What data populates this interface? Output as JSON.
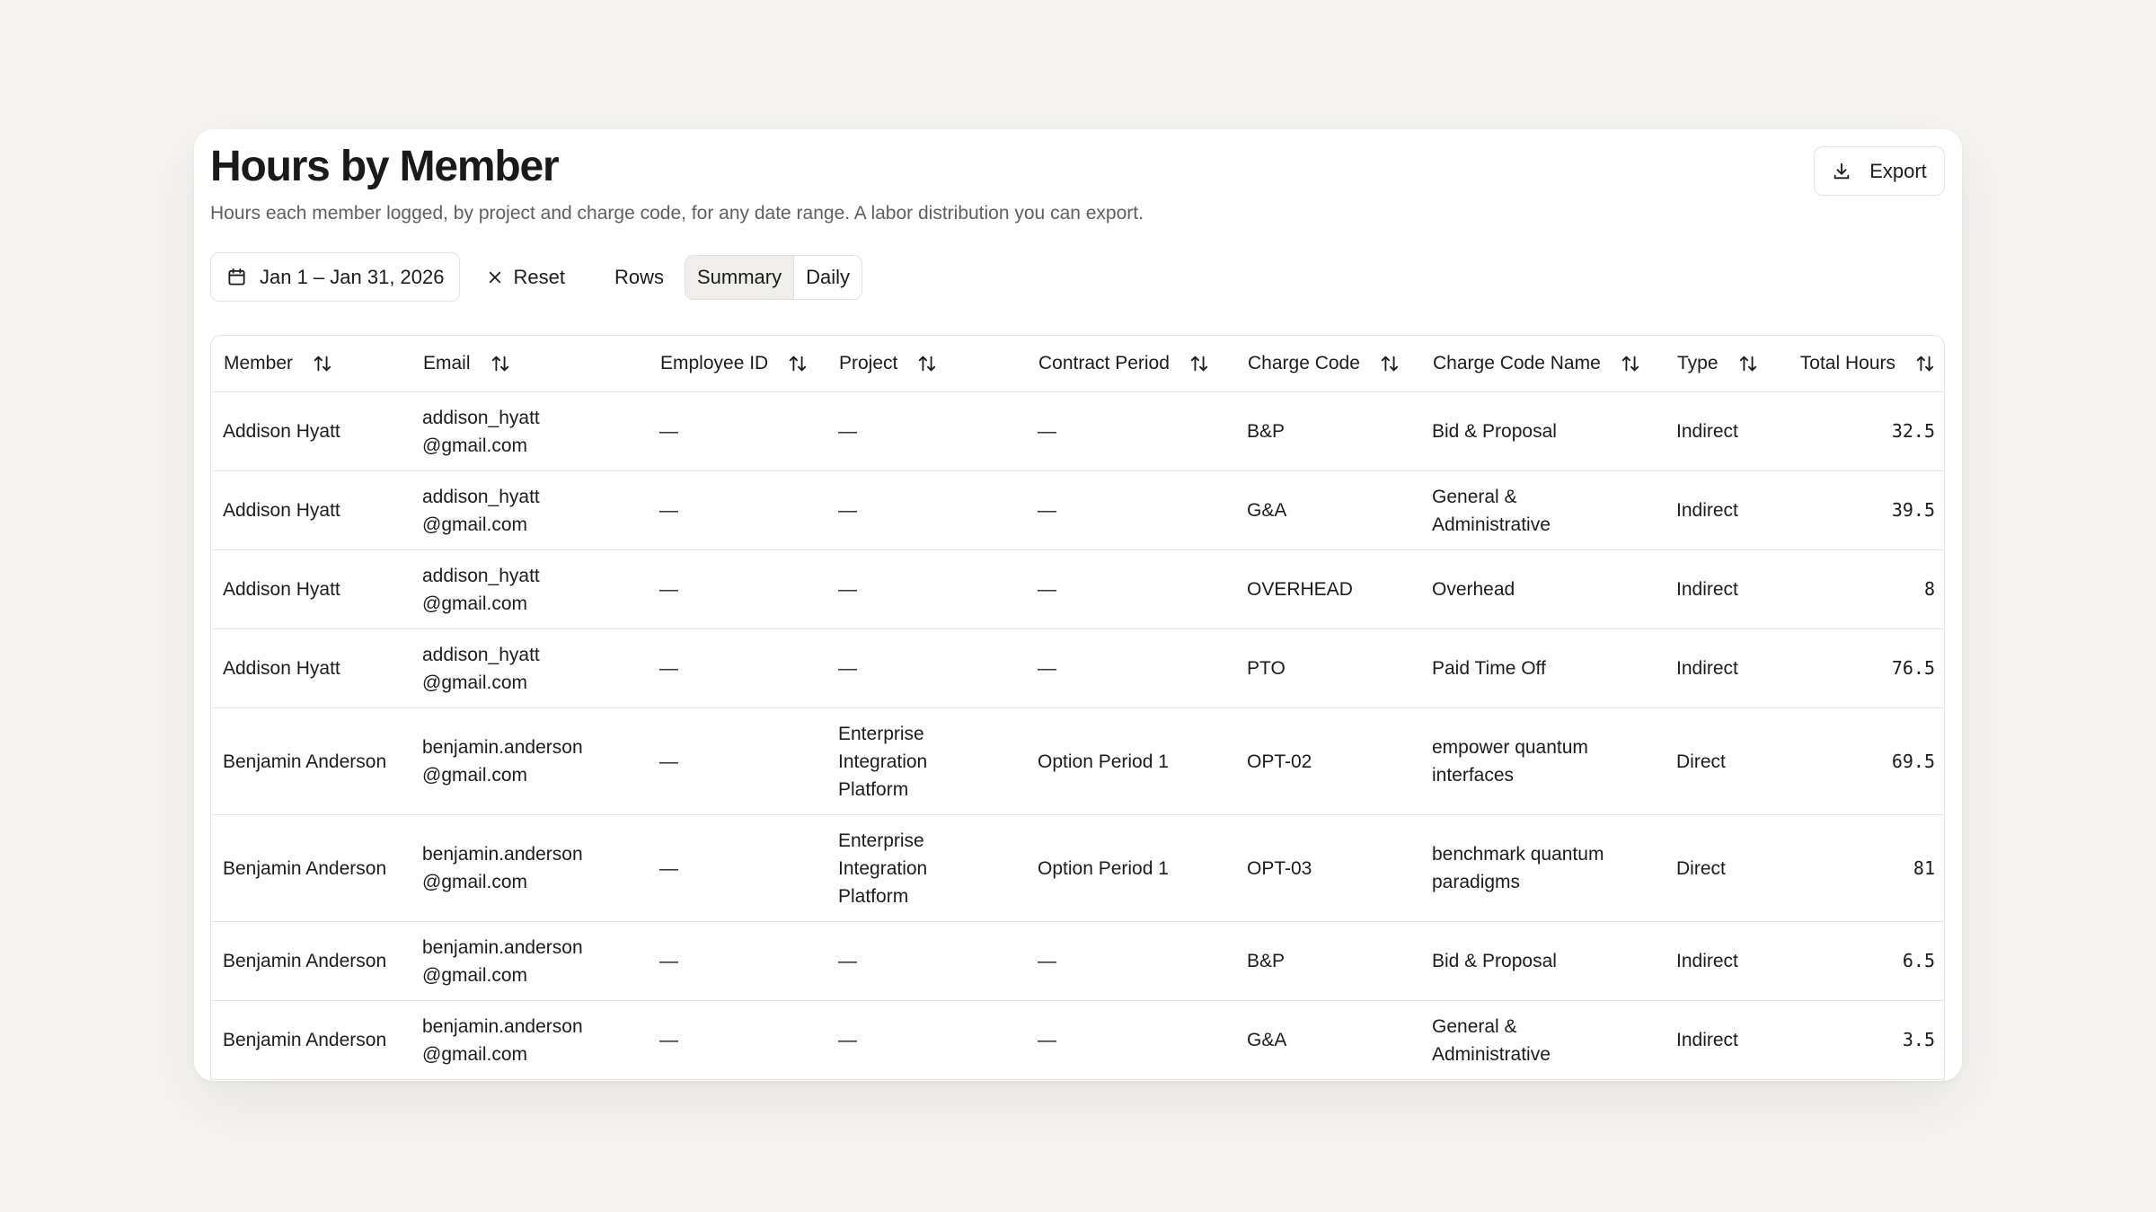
{
  "page": {
    "title": "Hours by Member",
    "subtitle": "Hours each member logged, by project and charge code, for any date range. A labor distribution you can export.",
    "export_label": "Export"
  },
  "toolbar": {
    "date_range": "Jan 1 – Jan 31, 2026",
    "reset_label": "Reset",
    "rows_label": "Rows",
    "rows_options": [
      "Summary",
      "Daily"
    ],
    "rows_selected": "Summary"
  },
  "icons": {
    "export": "download-icon",
    "date": "calendar-icon",
    "reset": "close-icon",
    "sort": "sort-arrows-icon"
  },
  "table": {
    "columns": [
      "Member",
      "Email",
      "Employee ID",
      "Project",
      "Contract Period",
      "Charge Code",
      "Charge Code Name",
      "Type",
      "Total Hours"
    ],
    "rows": [
      {
        "member": "Addison Hyatt",
        "email_user": "addison_hyatt",
        "email_domain": "@gmail.com",
        "employee_id": "—",
        "project": [
          "—"
        ],
        "contract_period": "—",
        "charge_code": "B&P",
        "charge_code_name": [
          "Bid & Proposal"
        ],
        "type": "Indirect",
        "total_hours": "32.5"
      },
      {
        "member": "Addison Hyatt",
        "email_user": "addison_hyatt",
        "email_domain": "@gmail.com",
        "employee_id": "—",
        "project": [
          "—"
        ],
        "contract_period": "—",
        "charge_code": "G&A",
        "charge_code_name": [
          "General &",
          "Administrative"
        ],
        "type": "Indirect",
        "total_hours": "39.5"
      },
      {
        "member": "Addison Hyatt",
        "email_user": "addison_hyatt",
        "email_domain": "@gmail.com",
        "employee_id": "—",
        "project": [
          "—"
        ],
        "contract_period": "—",
        "charge_code": "OVERHEAD",
        "charge_code_name": [
          "Overhead"
        ],
        "type": "Indirect",
        "total_hours": "8"
      },
      {
        "member": "Addison Hyatt",
        "email_user": "addison_hyatt",
        "email_domain": "@gmail.com",
        "employee_id": "—",
        "project": [
          "—"
        ],
        "contract_period": "—",
        "charge_code": "PTO",
        "charge_code_name": [
          "Paid Time Off"
        ],
        "type": "Indirect",
        "total_hours": "76.5"
      },
      {
        "member": "Benjamin Anderson",
        "email_user": "benjamin.anderson",
        "email_domain": "@gmail.com",
        "employee_id": "—",
        "project": [
          "Enterprise",
          "Integration",
          "Platform"
        ],
        "contract_period": "Option Period 1",
        "charge_code": "OPT-02",
        "charge_code_name": [
          "empower quantum",
          "interfaces"
        ],
        "type": "Direct",
        "total_hours": "69.5"
      },
      {
        "member": "Benjamin Anderson",
        "email_user": "benjamin.anderson",
        "email_domain": "@gmail.com",
        "employee_id": "—",
        "project": [
          "Enterprise",
          "Integration",
          "Platform"
        ],
        "contract_period": "Option Period 1",
        "charge_code": "OPT-03",
        "charge_code_name": [
          "benchmark quantum",
          "paradigms"
        ],
        "type": "Direct",
        "total_hours": "81"
      },
      {
        "member": "Benjamin Anderson",
        "email_user": "benjamin.anderson",
        "email_domain": "@gmail.com",
        "employee_id": "—",
        "project": [
          "—"
        ],
        "contract_period": "—",
        "charge_code": "B&P",
        "charge_code_name": [
          "Bid & Proposal"
        ],
        "type": "Indirect",
        "total_hours": "6.5"
      },
      {
        "member": "Benjamin Anderson",
        "email_user": "benjamin.anderson",
        "email_domain": "@gmail.com",
        "employee_id": "—",
        "project": [
          "—"
        ],
        "contract_period": "—",
        "charge_code": "G&A",
        "charge_code_name": [
          "General &",
          "Administrative"
        ],
        "type": "Indirect",
        "total_hours": "3.5"
      }
    ]
  }
}
